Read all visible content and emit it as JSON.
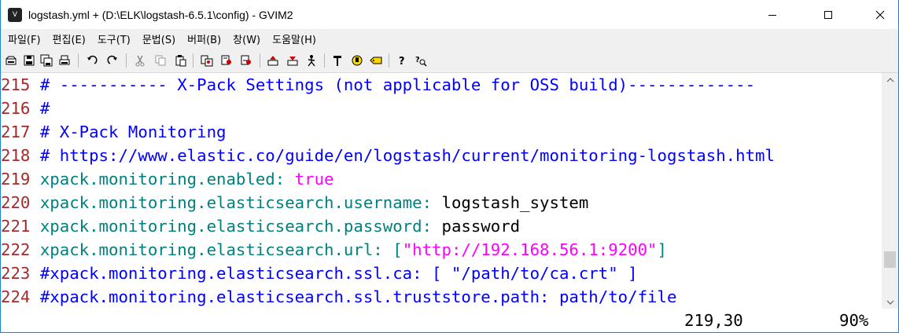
{
  "window": {
    "title": "logstash.yml + (D:\\ELK\\logstash-6.5.1\\config) - GVIM2",
    "icon": "vim-icon",
    "controls": [
      "minimize-icon",
      "maximize-icon",
      "close-icon"
    ]
  },
  "menu": {
    "items": [
      "파일(F)",
      "편집(E)",
      "도구(T)",
      "문법(S)",
      "버퍼(B)",
      "창(W)",
      "도움말(H)"
    ]
  },
  "toolbar": {
    "buttons": [
      "open-icon",
      "save-icon",
      "save-all-icon",
      "print-icon",
      "undo-icon",
      "redo-icon",
      "cut-icon",
      "copy-icon",
      "paste-icon",
      "find-replace-icon",
      "find-next-icon",
      "find-prev-icon",
      "load-session-icon",
      "save-session-icon",
      "run-script-icon",
      "make-icon",
      "run-ctags-icon",
      "tag-jump-icon",
      "help-icon",
      "find-help-icon"
    ]
  },
  "editor": {
    "lines": [
      {
        "num": "215",
        "segments": [
          {
            "text": " # ----------- X-Pack Settings (not applicable for OSS build)-------------",
            "kind": "comment"
          }
        ]
      },
      {
        "num": "216",
        "segments": [
          {
            "text": " #",
            "kind": "comment"
          }
        ]
      },
      {
        "num": "217",
        "segments": [
          {
            "text": " # X-Pack Monitoring",
            "kind": "comment"
          }
        ]
      },
      {
        "num": "218",
        "segments": [
          {
            "text": " # https://www.elastic.co/guide/en/logstash/current/monitoring-logstash.html",
            "kind": "comment"
          }
        ]
      },
      {
        "num": "219",
        "segments": [
          {
            "text": " xpack.monitoring.enabled:",
            "kind": "key"
          },
          {
            "text": " true",
            "kind": "bool"
          }
        ]
      },
      {
        "num": "220",
        "segments": [
          {
            "text": " xpack.monitoring.elasticsearch.username:",
            "kind": "key"
          },
          {
            "text": " logstash_system",
            "kind": "plain"
          }
        ]
      },
      {
        "num": "221",
        "segments": [
          {
            "text": " xpack.monitoring.elasticsearch.password:",
            "kind": "key"
          },
          {
            "text": " password",
            "kind": "plain"
          }
        ]
      },
      {
        "num": "222",
        "segments": [
          {
            "text": " xpack.monitoring.elasticsearch.url:",
            "kind": "key"
          },
          {
            "text": " [",
            "kind": "key"
          },
          {
            "text": "\"http://192.168.56.1:9200\"",
            "kind": "str"
          },
          {
            "text": "]",
            "kind": "key"
          }
        ]
      },
      {
        "num": "223",
        "segments": [
          {
            "text": " #xpack.monitoring.elasticsearch.ssl.ca: [ \"/path/to/ca.crt\" ]",
            "kind": "comment"
          }
        ]
      },
      {
        "num": "224",
        "segments": [
          {
            "text": " #xpack.monitoring.elasticsearch.ssl.truststore.path: path/to/file",
            "kind": "comment"
          }
        ]
      }
    ],
    "status": {
      "position": "219,30",
      "percent": "90%"
    }
  },
  "scrollbar": {
    "thumb_position": 0.9
  },
  "colors": {
    "line_number": "#a52a2a",
    "comment": "#0000ff",
    "key": "#008080",
    "string": "#ff00ff"
  }
}
